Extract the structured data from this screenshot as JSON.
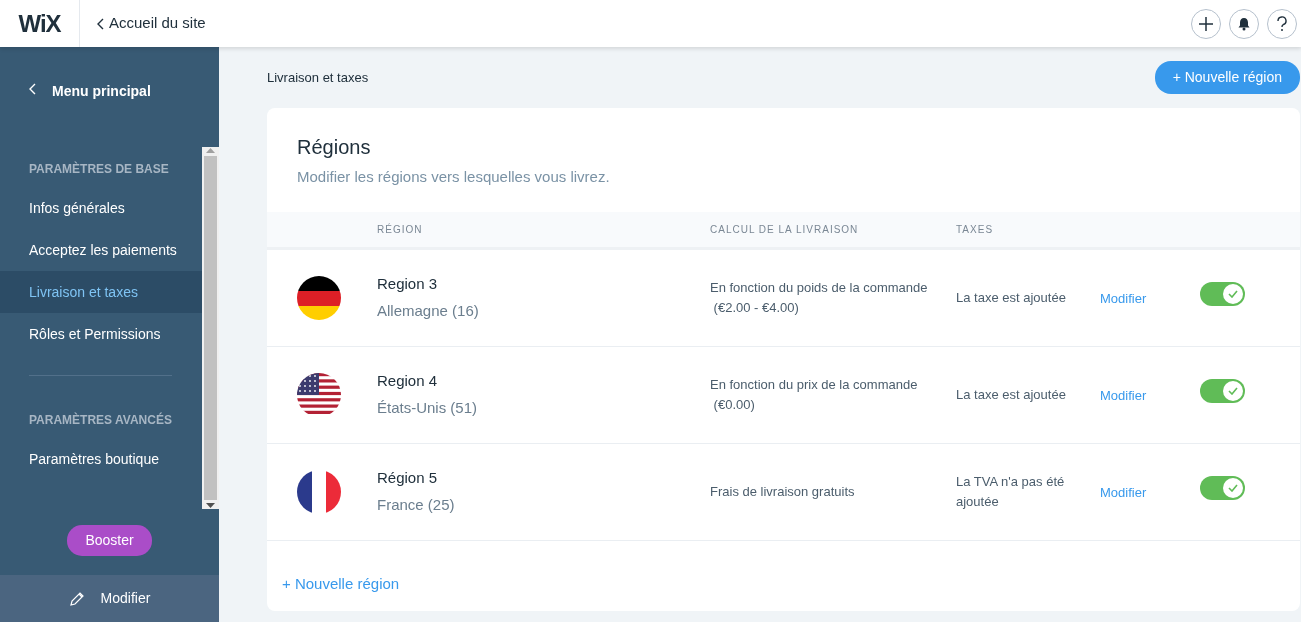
{
  "header": {
    "logo": "WiX",
    "back_link": "Accueil du site"
  },
  "sidebar": {
    "back": "Menu principal",
    "sections": [
      {
        "title": "PARAMÈTRES DE BASE",
        "items": [
          {
            "label": "Infos générales",
            "selected": false
          },
          {
            "label": "Acceptez les paiements",
            "selected": false
          },
          {
            "label": "Livraison et taxes",
            "selected": true
          },
          {
            "label": "Rôles et Permissions",
            "selected": false
          }
        ]
      },
      {
        "title": "PARAMÈTRES AVANCÉS",
        "items": [
          {
            "label": "Paramètres boutique",
            "selected": false
          }
        ]
      }
    ],
    "upgrade_button": "Booster",
    "edit_button": "Modifier"
  },
  "page": {
    "breadcrumb": "Livraison et taxes",
    "new_region_button": "+ Nouvelle région"
  },
  "regions_card": {
    "title": "Régions",
    "subtitle": "Modifier les régions vers lesquelles vous livrez.",
    "columns": [
      "RÉGION",
      "CALCUL DE LA LIVRAISON",
      "TAXES"
    ],
    "rows": [
      {
        "kind": "de",
        "name": "Region 3",
        "country": "Allemagne (16)",
        "shipping": "En fonction du poids de la commande",
        "shipping_range": "(€2.00 - €4.00)",
        "taxes": "La taxe est ajoutée",
        "edit": "Modifier",
        "on": true
      },
      {
        "kind": "us",
        "name": "Region 4",
        "country": "États-Unis (51)",
        "shipping": "En fonction du prix de la commande",
        "shipping_range": "(€0.00)",
        "taxes": "La taxe est ajoutée",
        "edit": "Modifier",
        "on": true
      },
      {
        "kind": "fr",
        "name": "Région 5",
        "country": "France (25)",
        "shipping": "Frais de livraison gratuits",
        "taxes": "La TVA n'a pas été ajoutée",
        "edit": "Modifier",
        "on": true
      }
    ],
    "add_link": "+ Nouvelle région"
  }
}
